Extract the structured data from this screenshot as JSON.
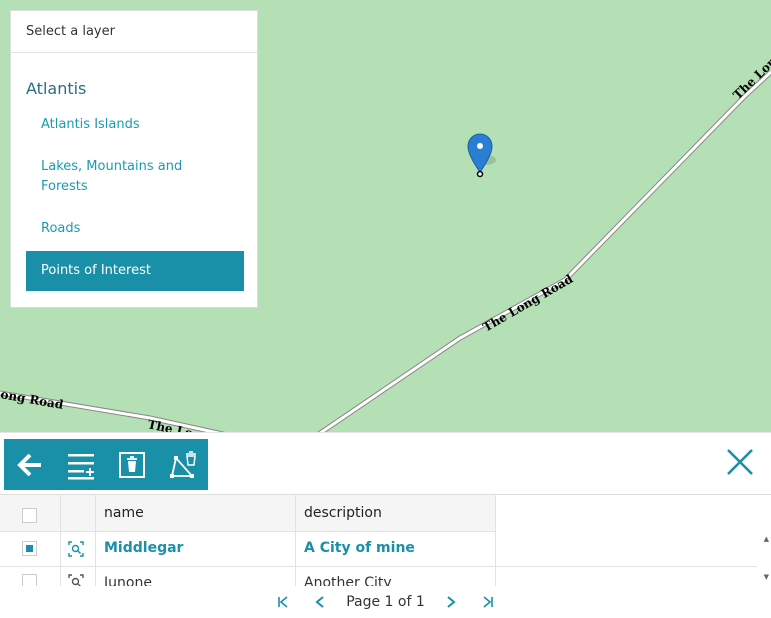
{
  "layer_panel": {
    "header": "Select a layer",
    "title": "Atlantis",
    "items": [
      {
        "label": "Atlantis Islands",
        "active": false
      },
      {
        "label": "Lakes, Mountains and Forests",
        "active": false
      },
      {
        "label": "Roads",
        "active": false
      },
      {
        "label": "Points of Interest",
        "active": true
      }
    ]
  },
  "map": {
    "road_labels": [
      "The Long Road",
      "The Long Road",
      "The Lo",
      "ong Road"
    ],
    "road_name": "The Long Road",
    "marker_color": "#2a7fd4"
  },
  "toolbar": {
    "buttons": [
      {
        "name": "back",
        "icon": "arrow-left-icon"
      },
      {
        "name": "add-feature",
        "icon": "list-add-icon"
      },
      {
        "name": "delete",
        "icon": "trash-icon"
      },
      {
        "name": "delete-geometry",
        "icon": "geometry-delete-icon"
      }
    ],
    "close_icon": "close-icon"
  },
  "grid": {
    "columns": [
      "name",
      "description"
    ],
    "rows": [
      {
        "name": "Middlegar",
        "description": "A City of mine",
        "selected": true
      },
      {
        "name": "Junone",
        "description": "Another City",
        "selected": false
      }
    ]
  },
  "pager": {
    "label": "Page 1 of 1"
  },
  "colors": {
    "accent": "#1a8fa8",
    "map_bg": "#b5dfb5"
  }
}
